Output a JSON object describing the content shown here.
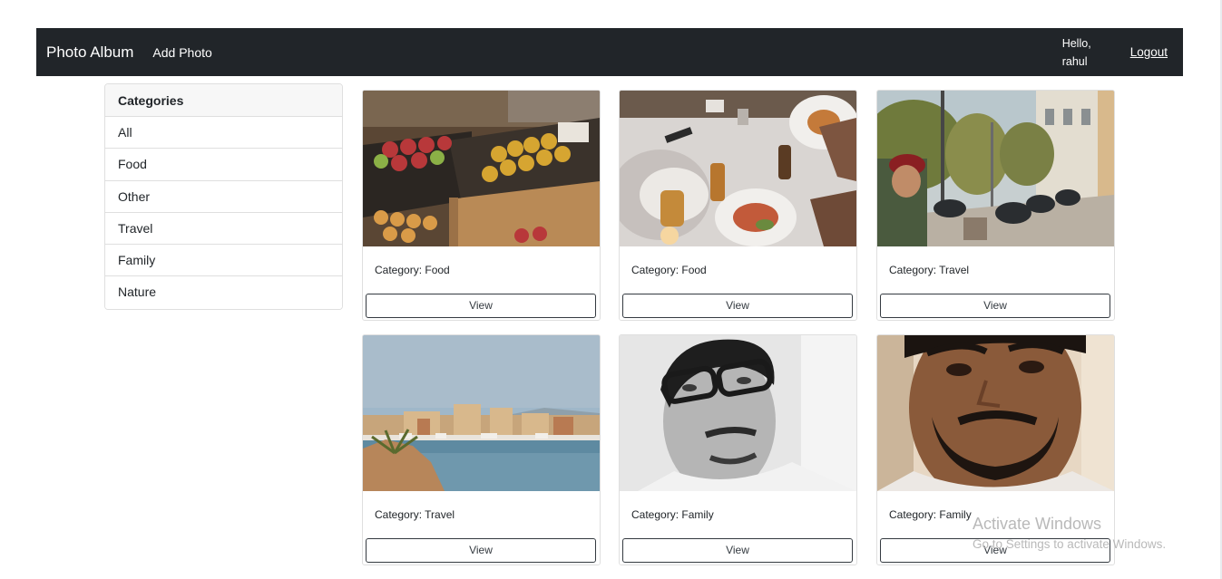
{
  "navbar": {
    "brand": "Photo Album",
    "add_photo": "Add Photo",
    "greeting_line1": "Hello,",
    "greeting_line2": "rahul",
    "logout": "Logout"
  },
  "sidebar": {
    "header": "Categories",
    "items": [
      {
        "label": "All"
      },
      {
        "label": "Food"
      },
      {
        "label": "Other"
      },
      {
        "label": "Travel"
      },
      {
        "label": "Family"
      },
      {
        "label": "Nature"
      }
    ]
  },
  "photos": [
    {
      "category": "Category: Food",
      "button": "View",
      "image": "fruit-market-photo"
    },
    {
      "category": "Category: Food",
      "button": "View",
      "image": "dinner-table-photo"
    },
    {
      "category": "Category: Travel",
      "button": "View",
      "image": "street-scene-photo"
    },
    {
      "category": "Category: Travel",
      "button": "View",
      "image": "harbor-town-photo"
    },
    {
      "category": "Category: Family",
      "button": "View",
      "image": "portrait-glasses-photo"
    },
    {
      "category": "Category: Family",
      "button": "View",
      "image": "portrait-selfie-photo"
    }
  ],
  "watermark": {
    "title": "Activate Windows",
    "subtitle": "Go to Settings to activate Windows."
  },
  "colors": {
    "navbar_bg": "#212529",
    "border": "#dfdfdf",
    "button_border": "#343a40"
  }
}
